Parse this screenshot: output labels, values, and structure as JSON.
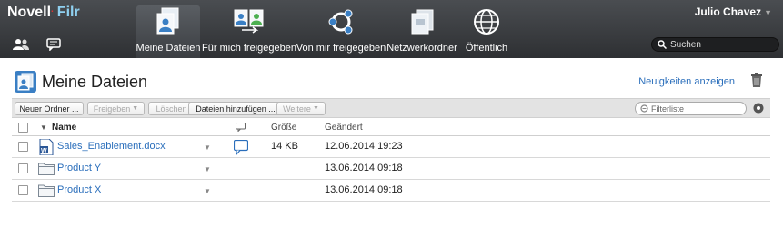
{
  "app": {
    "brand": "Novell",
    "product": "Filr",
    "user": "Julio Chavez"
  },
  "nav": [
    {
      "label": "Meine Dateien",
      "icon": "my-files-icon",
      "active": true
    },
    {
      "label": "Für mich freigegeben",
      "icon": "shared-with-me-icon",
      "active": false
    },
    {
      "label": "Von mir freigegeben",
      "icon": "shared-by-me-icon",
      "active": false
    },
    {
      "label": "Netzwerkordner",
      "icon": "net-folders-icon",
      "active": false
    },
    {
      "label": "Öffentlich",
      "icon": "public-globe-icon",
      "active": false
    }
  ],
  "search": {
    "placeholder": "Suchen"
  },
  "page": {
    "title": "Meine Dateien",
    "news_link": "Neuigkeiten anzeigen"
  },
  "toolbar": {
    "new_folder": "Neuer Ordner ...",
    "share": "Freigeben",
    "delete": "Löschen",
    "add_files": "Dateien hinzufügen ...",
    "more": "Weitere",
    "filter_placeholder": "Filterliste"
  },
  "columns": {
    "name": "Name",
    "size": "Größe",
    "modified": "Geändert"
  },
  "rows": [
    {
      "name": "Sales_Enablement.docx",
      "type": "docx",
      "size": "14 KB",
      "modified": "12.06.2014 19:23",
      "has_comment": true
    },
    {
      "name": "Product Y",
      "type": "folder",
      "size": "",
      "modified": "13.06.2014 09:18",
      "has_comment": false
    },
    {
      "name": "Product X",
      "type": "folder",
      "size": "",
      "modified": "13.06.2014 09:18",
      "has_comment": false
    }
  ],
  "colors": {
    "accent": "#2a6ebb",
    "topbar": "#3a3d41",
    "filr": "#8fd0f0"
  }
}
